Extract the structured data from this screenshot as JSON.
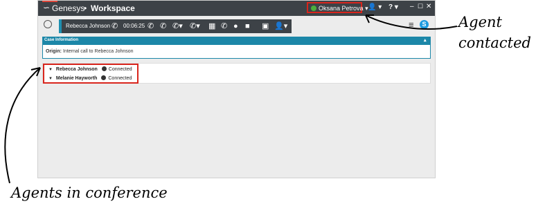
{
  "titlebar": {
    "brand": "Genesys",
    "separator": "•",
    "app_name": "Workspace",
    "user_name": "Oksana Petrova",
    "status_color": "#4cae3b"
  },
  "toolbar": {
    "caller_name": "Rebecca Johnson",
    "timer": "00:06:25",
    "icons": [
      "end-call-icon",
      "hold-call-icon",
      "instant-transfer-icon",
      "instant-conference-icon",
      "keypad-icon",
      "consult-icon",
      "mute-icon",
      "video-icon",
      "schedule-callback-icon",
      "add-party-icon"
    ]
  },
  "case": {
    "header": "Case Information",
    "origin_label": "Origin:",
    "origin_value": "Internal call to Rebecca Johnson"
  },
  "parties": [
    {
      "name": "Rebecca Johnson",
      "status": "Connected"
    },
    {
      "name": "Melanie Hayworth",
      "status": "Connected"
    }
  ],
  "annotations": {
    "agent_contacted": [
      "Agent",
      "contacted"
    ],
    "agents_in_conference": "Agents in conference"
  },
  "colors": {
    "accent_blue": "#1c87a8",
    "highlight_red": "#d9251c",
    "titlebar_dark": "#3d4247"
  }
}
